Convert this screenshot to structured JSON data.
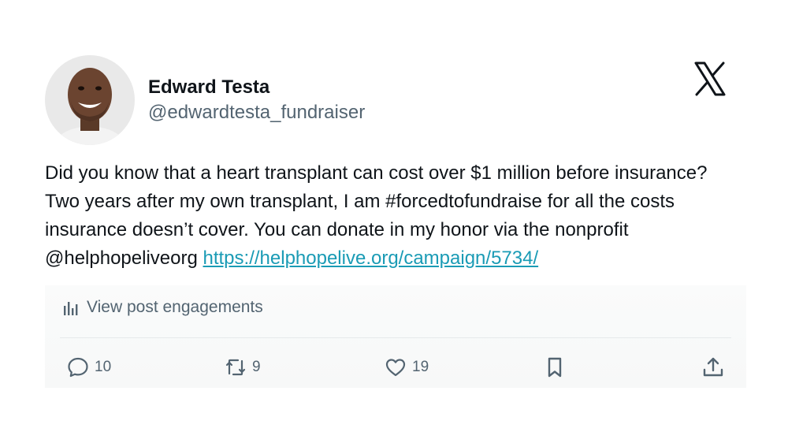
{
  "author": {
    "display_name": "Edward Testa",
    "handle": "@edwardtesta_fundraiser",
    "avatar_icon": "avatar-photo"
  },
  "brand": {
    "logo_icon": "x-logo-icon"
  },
  "tweet": {
    "text_parts": [
      "Did you know that a heart transplant can cost over $1 million before insurance? Two years after my own transplant, I am #forcedtofundraise for all the costs insurance doesn’t cover. You can donate in my honor via the nonprofit @helphopeliveorg "
    ],
    "link": "https://helphopelive.org/campaign/5734/"
  },
  "engagements": {
    "label": "View post engagements",
    "icon": "bar-chart-icon"
  },
  "actions": {
    "reply_count": "10",
    "repost_count": "9",
    "like_count": "19"
  },
  "colors": {
    "text": "#0f1419",
    "secondary": "#536471",
    "link": "#1a9bb5",
    "divider": "#e6e9eb"
  }
}
